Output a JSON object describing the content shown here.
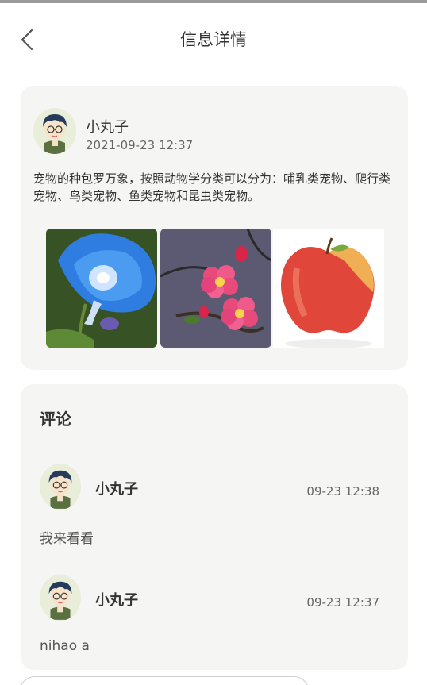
{
  "header": {
    "title": "信息详情",
    "back_icon": "chevron-left-icon"
  },
  "post": {
    "author": "小丸子",
    "time": "2021-09-23 12:37",
    "content": "宠物的种包罗万象，按照动物学分类可以分为：哺乳类宠物、爬行类宠物、鸟类宠物、鱼类宠物和昆虫类宠物。",
    "images": [
      "blue-morning-glory-photo",
      "pink-flowers-photo",
      "red-apple-photo"
    ]
  },
  "comments": {
    "title": "评论",
    "items": [
      {
        "author": "小丸子",
        "time": "09-23 12:38",
        "text": "我来看看"
      },
      {
        "author": "小丸子",
        "time": "09-23 12:37",
        "text": "nihao a"
      }
    ]
  },
  "colors": {
    "card_bg": "#f5f5f4",
    "page_bg": "#ffffff",
    "text": "#333333",
    "muted": "#666666"
  }
}
